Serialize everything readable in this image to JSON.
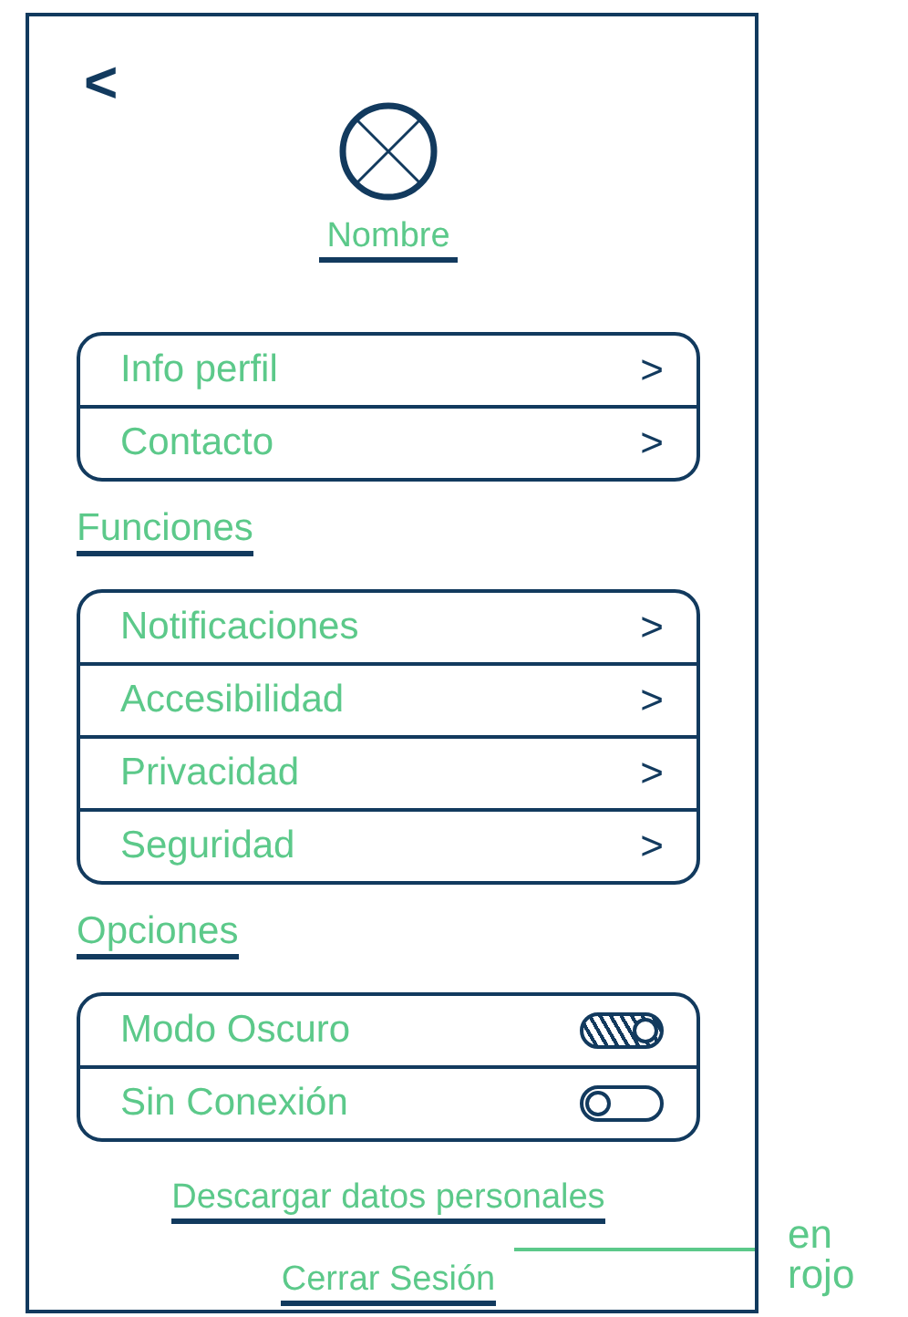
{
  "header": {
    "back": "<",
    "name": "Nombre"
  },
  "groups": [
    {
      "items": [
        {
          "kind": "link",
          "label": "Info perfil",
          "chevron": ">"
        },
        {
          "kind": "link",
          "label": "Contacto",
          "chevron": ">"
        }
      ]
    },
    {
      "title": "Funciones",
      "items": [
        {
          "kind": "link",
          "label": "Notificaciones",
          "chevron": ">"
        },
        {
          "kind": "link",
          "label": "Accesibilidad",
          "chevron": ">"
        },
        {
          "kind": "link",
          "label": "Privacidad",
          "chevron": ">"
        },
        {
          "kind": "link",
          "label": "Seguridad",
          "chevron": ">"
        }
      ]
    },
    {
      "title": "Opciones",
      "items": [
        {
          "kind": "toggle",
          "label": "Modo Oscuro",
          "on": true
        },
        {
          "kind": "toggle",
          "label": "Sin Conexión",
          "on": false
        }
      ]
    }
  ],
  "actions": [
    {
      "label": "Descargar datos personales"
    },
    {
      "label": "Cerrar Sesión"
    }
  ],
  "note": "en rojo"
}
